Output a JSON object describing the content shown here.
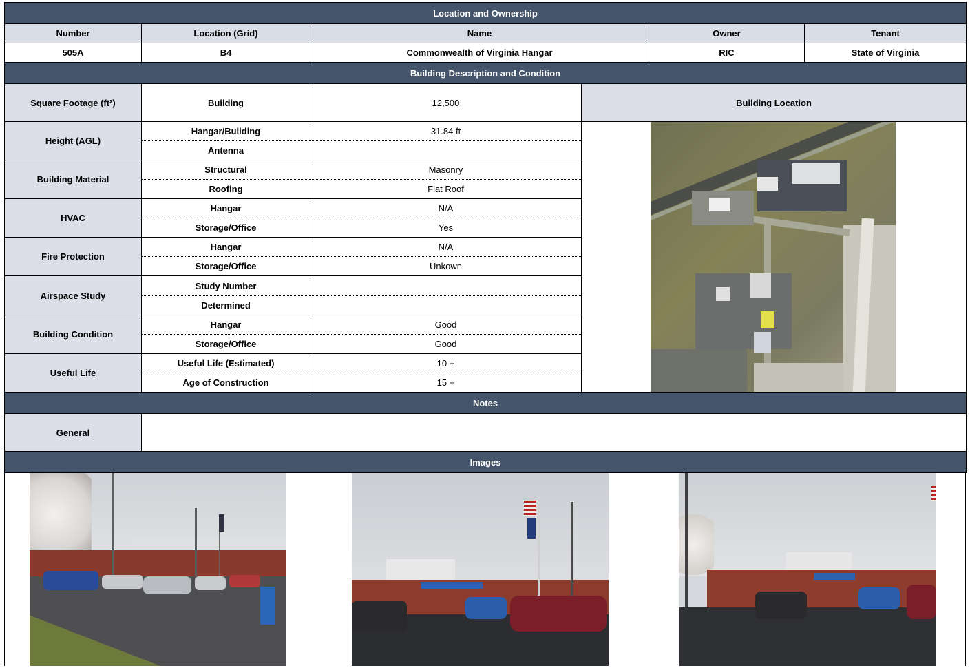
{
  "location_ownership": {
    "title": "Location and Ownership",
    "headers": [
      "Number",
      "Location (Grid)",
      "Name",
      "Owner",
      "Tenant"
    ],
    "values": [
      "505A",
      "B4",
      "Commonwealth of Virginia Hangar",
      "RIC",
      "State of Virginia"
    ]
  },
  "building": {
    "title": "Building Description and Condition",
    "location_label": "Building Location",
    "square_footage": {
      "label": "Square Footage (ft²)",
      "sub": "Building",
      "value": "12,500"
    },
    "rows": [
      {
        "label": "Height (AGL)",
        "items": [
          {
            "sub": "Hangar/Building",
            "value": "31.84 ft"
          },
          {
            "sub": "Antenna",
            "value": ""
          }
        ]
      },
      {
        "label": "Building Material",
        "items": [
          {
            "sub": "Structural",
            "value": "Masonry"
          },
          {
            "sub": "Roofing",
            "value": "Flat Roof"
          }
        ]
      },
      {
        "label": "HVAC",
        "items": [
          {
            "sub": "Hangar",
            "value": "N/A"
          },
          {
            "sub": "Storage/Office",
            "value": "Yes"
          }
        ]
      },
      {
        "label": "Fire Protection",
        "items": [
          {
            "sub": "Hangar",
            "value": "N/A"
          },
          {
            "sub": "Storage/Office",
            "value": "Unkown"
          }
        ]
      },
      {
        "label": "Airspace Study",
        "items": [
          {
            "sub": "Study Number",
            "value": ""
          },
          {
            "sub": "Determined",
            "value": ""
          }
        ]
      },
      {
        "label": "Building Condition",
        "items": [
          {
            "sub": "Hangar",
            "value": "Good"
          },
          {
            "sub": "Storage/Office",
            "value": "Good"
          }
        ]
      },
      {
        "label": "Useful Life",
        "items": [
          {
            "sub": "Useful Life (Estimated)",
            "value": "10 +"
          },
          {
            "sub": "Age of Construction",
            "value": "15 +"
          }
        ]
      }
    ]
  },
  "notes": {
    "title": "Notes",
    "general_label": "General",
    "general_value": ""
  },
  "images": {
    "title": "Images"
  },
  "colors": {
    "band": "#44546a",
    "header": "#d9dde6",
    "label_cell": "#dcdfe8"
  }
}
